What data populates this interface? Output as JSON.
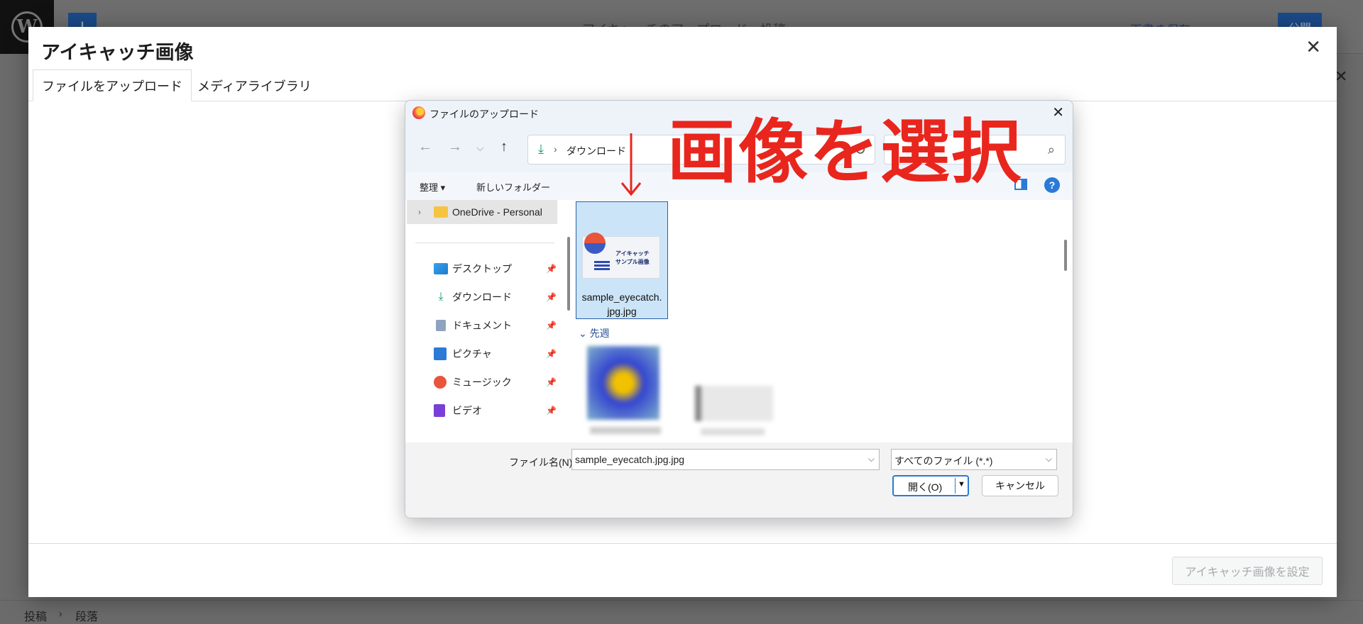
{
  "editor": {
    "title": "アイキャッチのアップロード - 投稿",
    "draft_label": "下書き保存",
    "publish_label": "公開",
    "breadcrumb": [
      "投稿",
      "段落"
    ]
  },
  "modal": {
    "title": "アイキャッチ画像",
    "tabs": [
      "ファイルをアップロード",
      "メディアライブラリ"
    ],
    "set_button": "アイキャッチ画像を設定"
  },
  "dialog": {
    "title": "ファイルのアップロード",
    "address": "ダウンロード",
    "toolbar": {
      "organize": "整理 ▾",
      "new_folder": "新しいフォルダー"
    },
    "nav_items": [
      {
        "label": "OneDrive - Personal",
        "icon": "folder-icon"
      },
      {
        "label": "デスクトップ",
        "icon": "desktop-icon"
      },
      {
        "label": "ダウンロード",
        "icon": "download-icon"
      },
      {
        "label": "ドキュメント",
        "icon": "document-icon"
      },
      {
        "label": "ピクチャ",
        "icon": "picture-icon"
      },
      {
        "label": "ミュージック",
        "icon": "music-icon"
      },
      {
        "label": "ビデオ",
        "icon": "video-icon"
      }
    ],
    "selected_file": {
      "name_line1": "sample_eyecatch.",
      "name_line2": "jpg.jpg",
      "thumb_line1": "アイキャッチ",
      "thumb_line2": "サンプル画像"
    },
    "group_header": "先週",
    "filename_label": "ファイル名(N):",
    "filename_value": "sample_eyecatch.jpg.jpg",
    "filetype_value": "すべてのファイル (*.*)",
    "open_button": "開く(O)",
    "cancel_button": "キャンセル"
  },
  "annotation": {
    "text": "画像を選択",
    "color": "#e8261d"
  }
}
